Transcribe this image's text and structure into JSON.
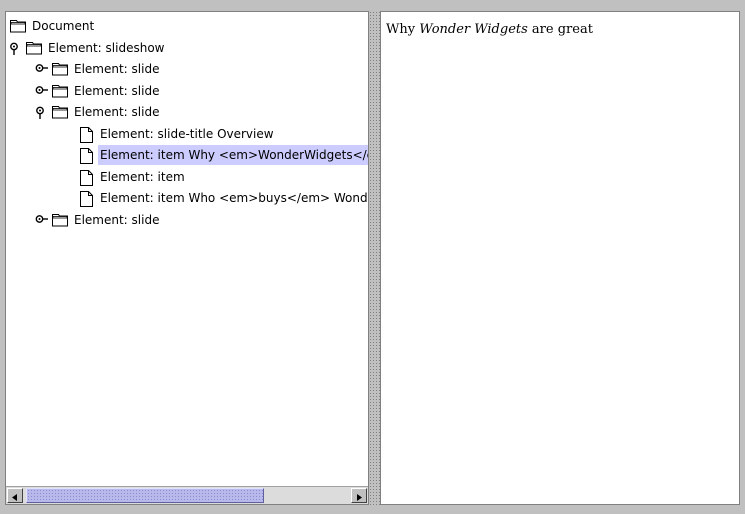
{
  "tree": {
    "nodes": [
      {
        "label": "Document",
        "icon": "folder-icon",
        "handle": "none",
        "level": 0,
        "selected": false
      },
      {
        "label": "Element: slideshow",
        "icon": "folder-icon",
        "handle": "expanded",
        "level": 0,
        "selected": false
      },
      {
        "label": "Element: slide",
        "icon": "folder-icon",
        "handle": "collapsed",
        "level": 1,
        "selected": false
      },
      {
        "label": "Element: slide",
        "icon": "folder-icon",
        "handle": "collapsed",
        "level": 1,
        "selected": false
      },
      {
        "label": "Element: slide",
        "icon": "folder-icon",
        "handle": "expanded",
        "level": 1,
        "selected": false
      },
      {
        "label": "Element: slide-title Overview",
        "icon": "file-icon",
        "handle": "none",
        "level": 2,
        "selected": false
      },
      {
        "label": "Element: item Why <em>WonderWidgets</em> are great",
        "icon": "file-icon",
        "handle": "none",
        "level": 2,
        "selected": true
      },
      {
        "label": "Element: item",
        "icon": "file-icon",
        "handle": "none",
        "level": 2,
        "selected": false
      },
      {
        "label": "Element: item Who <em>buys</em> WonderWidgets",
        "icon": "file-icon",
        "handle": "none",
        "level": 2,
        "selected": false
      },
      {
        "label": "Element: slide",
        "icon": "folder-icon",
        "handle": "collapsed",
        "level": 1,
        "selected": false
      }
    ]
  },
  "content": {
    "before": "Why ",
    "emphasis": "Wonder Widgets",
    "after": " are great"
  },
  "scrollbar": {
    "horizontal_position": 0.0,
    "visible_fraction": 0.68
  }
}
